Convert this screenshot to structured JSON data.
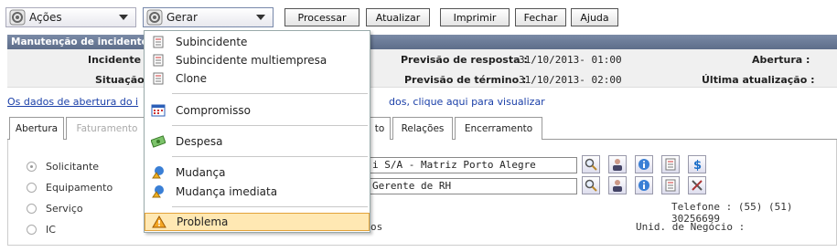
{
  "toolbar": {
    "acoes_label": "Ações",
    "gerar_label": "Gerar",
    "buttons": [
      "Processar",
      "Atualizar",
      "Imprimir",
      "Fechar",
      "Ajuda"
    ]
  },
  "header": {
    "title": "Manutenção de incidente"
  },
  "info": {
    "incidente_label": "Incidente :",
    "situacao_label": "Situação :",
    "prev_resposta_label": "Previsão de resposta :",
    "prev_resposta_value": "31/10/2013- 01:00",
    "prev_termino_label": "Previsão de término :",
    "prev_termino_value": "31/10/2013- 02:00",
    "abertura_label": "Abertura :",
    "ultima_label": "Última atualização :"
  },
  "link": {
    "part1": "Os dados de abertura do i",
    "part2": "dos, clique aqui para visualizar"
  },
  "tabs": [
    "Abertura",
    "Faturamento",
    "to",
    "Relações",
    "Encerramento"
  ],
  "form": {
    "radios": [
      "Solicitante",
      "Equipamento",
      "Serviço",
      "IC"
    ],
    "solicitante_value": "i S/A - Matriz Porto Alegre",
    "equipamento_value": "Gerente de RH",
    "telefone": "Telefone : (55) (51) 30256699",
    "unid_negocio": "Unid. de Negócio :",
    "os_partial": "os"
  },
  "menu": {
    "items": [
      "Subincidente",
      "Subincidente multiempresa",
      "Clone",
      "Compromisso",
      "Despesa",
      "Mudança",
      "Mudança imediata",
      "Problema"
    ]
  },
  "colors": {
    "header_bg": "#6a7a96",
    "link": "#1a3fa8",
    "highlight": "#ffe8b3"
  }
}
